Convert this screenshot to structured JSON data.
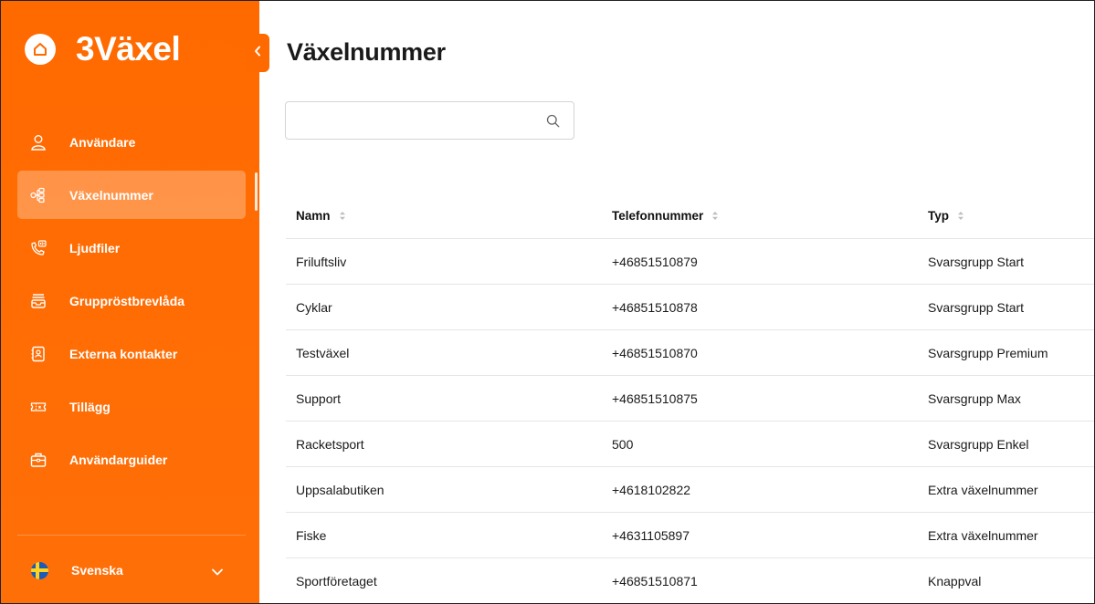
{
  "brand": {
    "name": "3Växel",
    "accent": "#ff6a00"
  },
  "sidebar": {
    "items": [
      {
        "label": "Användare",
        "icon": "user-icon"
      },
      {
        "label": "Växelnummer",
        "icon": "org-chart-icon",
        "active": true
      },
      {
        "label": "Ljudfiler",
        "icon": "phone-audio-icon"
      },
      {
        "label": "Gruppröstbrevlåda",
        "icon": "voicemail-inbox-icon"
      },
      {
        "label": "Externa kontakter",
        "icon": "contact-book-icon"
      },
      {
        "label": "Tillägg",
        "icon": "addon-ticket-icon"
      },
      {
        "label": "Användarguider",
        "icon": "briefcase-icon"
      }
    ],
    "language": {
      "label": "Svenska",
      "icon": "sweden-flag-icon"
    }
  },
  "main": {
    "title": "Växelnummer",
    "search": {
      "value": "",
      "placeholder": ""
    },
    "table": {
      "columns": [
        "Namn",
        "Telefonnummer",
        "Typ"
      ],
      "rows": [
        [
          "Friluftsliv",
          "+46851510879",
          "Svarsgrupp Start"
        ],
        [
          "Cyklar",
          "+46851510878",
          "Svarsgrupp Start"
        ],
        [
          "Testväxel",
          "+46851510870",
          "Svarsgrupp Premium"
        ],
        [
          "Support",
          "+46851510875",
          "Svarsgrupp Max"
        ],
        [
          "Racketsport",
          "500",
          "Svarsgrupp Enkel"
        ],
        [
          "Uppsalabutiken",
          "+4618102822",
          "Extra växelnummer"
        ],
        [
          "Fiske",
          "+4631105897",
          "Extra växelnummer"
        ],
        [
          "Sportföretaget",
          "+46851510871",
          "Knappval"
        ]
      ]
    }
  }
}
